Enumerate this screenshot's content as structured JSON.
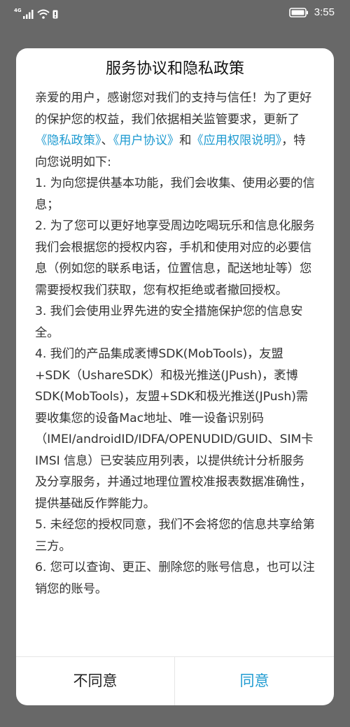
{
  "status_bar": {
    "network_label": "4G",
    "time": "3:55",
    "icons": [
      "signal-icon",
      "wifi-icon",
      "notification-icon",
      "battery-icon"
    ]
  },
  "dialog": {
    "title": "服务协议和隐私政策",
    "intro": {
      "part1": "亲爱的用户，感谢您对我们的支持与信任！为了更好的保护您的权益，我们依据相关监管要求，更新了",
      "link_privacy": "《隐私政策》",
      "sep1": "、",
      "link_user_agreement": "《用户协议》",
      "sep2": "和",
      "link_app_permission": "《应用权限说明》",
      "part2": "，特向您说明如下:"
    },
    "items": [
      " 1. 为向您提供基本功能，我们会收集、使用必要的信息；",
      " 2. 为了您可以更好地享受周边吃喝玩乐和信息化服务我们会根据您的授权内容，手机和使用对应的必要信息（例如您的联系电话，位置信息，配送地址等）您需要授权我们获取，您有权拒绝或者撤回授权。",
      " 3. 我们会使用业界先进的安全措施保护您的信息安全。",
      " 4. 我们的产品集成袤博SDK(MobTools)，友盟+SDK（UshareSDK）和极光推送(JPush)，袤博SDK(MobTools)，友盟+SDK和极光推送(JPush)需要收集您的设备Mac地址、唯一设备识别码（IMEI/androidID/IDFA/OPENUDID/GUID、SIM卡 IMSI 信息）已安装应用列表，以提供统计分析服务及分享服务，并通过地理位置校准报表数据准确性，提供基础反作弊能力。",
      " 5. 未经您的授权同意，我们不会将您的信息共享给第三方。",
      " 6. 您可以查询、更正、删除您的账号信息，也可以注销您的账号。"
    ],
    "buttons": {
      "disagree": "不同意",
      "agree": "同意"
    }
  },
  "colors": {
    "backdrop": "#686868",
    "link": "#1f9bd1",
    "text": "#333333",
    "title": "#111111"
  }
}
